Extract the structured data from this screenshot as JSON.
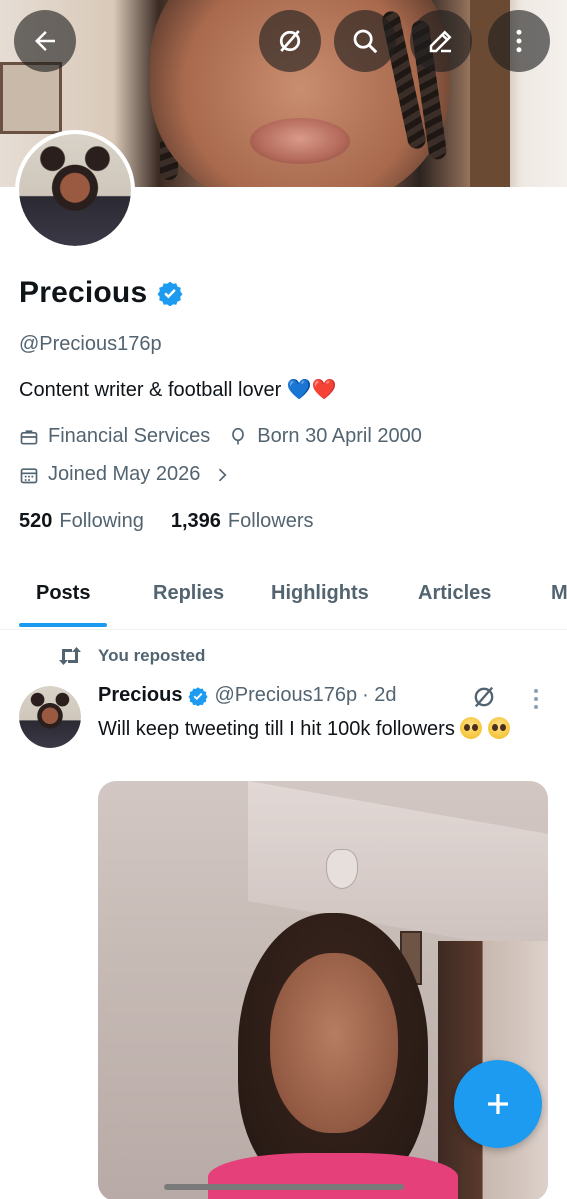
{
  "profile": {
    "name": "Precious",
    "handle": "@Precious176p",
    "bio": "Content writer & football lover 💙❤️",
    "category": "Financial Services",
    "birthday": "Born 30 April 2000",
    "joined": "Joined May 2026",
    "following_count": "520",
    "following_label": "Following",
    "followers_count": "1,396",
    "followers_label": "Followers"
  },
  "header_actions": {
    "back_icon": "arrow-left-icon",
    "grok_icon": "grok-icon",
    "search_icon": "search-icon",
    "edit_icon": "edit-pencil-icon",
    "more_icon": "more-vertical-icon"
  },
  "tabs": [
    {
      "label": "Posts",
      "active": true
    },
    {
      "label": "Replies",
      "active": false
    },
    {
      "label": "Highlights",
      "active": false
    },
    {
      "label": "Articles",
      "active": false
    },
    {
      "label": "M",
      "active": false
    }
  ],
  "post": {
    "repost_label": "You reposted",
    "author": "Precious",
    "handle": "@Precious176p",
    "time": "· 2d",
    "text": "Will keep tweeting till I hit 100k followers"
  },
  "colors": {
    "accent": "#1d9bf0",
    "text_primary": "#0f1419",
    "text_secondary": "#536471"
  },
  "fab_icon": "plus-icon"
}
